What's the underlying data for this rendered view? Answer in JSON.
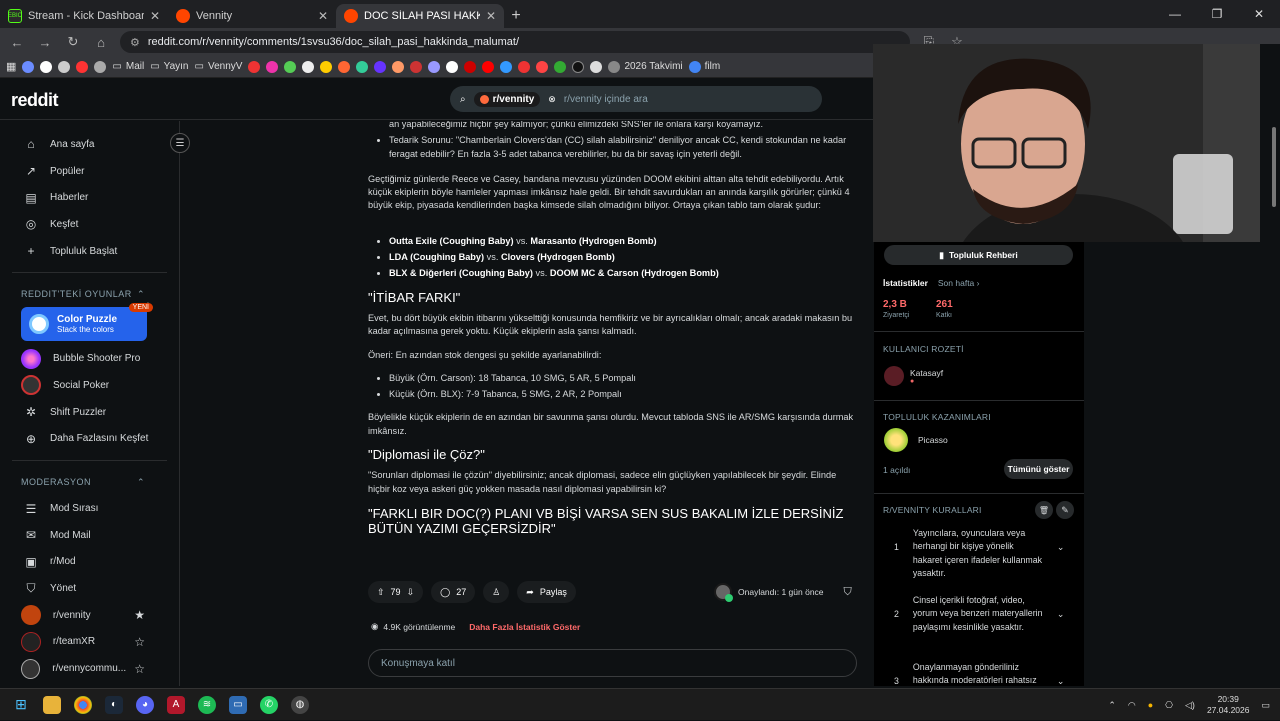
{
  "browser": {
    "tabs": [
      {
        "title": "Stream - Kick Dashboard",
        "favicon_color": "#53fc18",
        "badge": "EBIC"
      },
      {
        "title": "Vennity",
        "favicon_color": "#ff4500"
      },
      {
        "title": "DOC SİLAH PASI HAKKINDA M",
        "favicon_color": "#ff4500"
      }
    ],
    "url": "reddit.com/r/vennity/comments/1svsu36/doc_silah_pasi_hakkinda_malumat/",
    "bookmarks": [
      "Mail",
      "Yayın",
      "VennyV",
      "2026 Takvimi",
      "film"
    ]
  },
  "reddit": {
    "logo": "reddit",
    "search_chip": "r/vennity",
    "search_placeholder": "r/vennity içinde ara"
  },
  "sidebar": {
    "nav": [
      "Ana sayfa",
      "Popüler",
      "Haberler",
      "Keşfet",
      "Topluluk Başlat"
    ],
    "games_header": "REDDIT'TEKİ OYUNLAR",
    "promo": {
      "title": "Color Puzzle",
      "subtitle": "Stack the colors",
      "badge": "YENİ"
    },
    "games": [
      "Bubble Shooter Pro",
      "Social Poker",
      "Shift Puzzler",
      "Daha Fazlasını Keşfet"
    ],
    "mod_header": "MODERASYON",
    "mod": [
      "Mod Sırası",
      "Mod Mail",
      "r/Mod",
      "Yönet"
    ],
    "communities": [
      "r/vennity",
      "r/teamXR",
      "r/vennycommu..."
    ]
  },
  "post": {
    "bullet_a1": "an yapabileceğimiz hiçbir şey kalmıyor; çünkü elimizdeki SNS'ler ile onlara karşı koyamayız.",
    "bullet_a2": "Tedarik Sorunu: \"Chamberlain Clovers'dan (CC) silah alabilirsiniz\" deniliyor ancak CC, kendi stokundan ne kadar feragat edebilir? En fazla 3-5 adet tabanca verebilirler, bu da bir savaş için yeterli değil.",
    "para1": "Geçtiğimiz günlerde Reece ve Casey, bandana mevzusu yüzünden DOOM ekibini alttan alta tehdit edebiliyordu. Artık küçük ekiplerin böyle hamleler yapması imkânsız hale geldi. Bir tehdit savurdukları an anında karşılık görürler; çünkü 4 büyük ekip, piyasada kendilerinden başka kimsede silah olmadığını biliyor. Ortaya çıkan tablo tam olarak şudur:",
    "matchups": [
      {
        "a": "Outta Exile (Coughing Baby)",
        "vs": "vs.",
        "b": "Marasanto (Hydrogen Bomb)"
      },
      {
        "a": "LDA (Coughing Baby)",
        "vs": "vs.",
        "b": "Clovers (Hydrogen Bomb)"
      },
      {
        "a": "BLX & Diğerleri (Coughing Baby)",
        "vs": "vs.",
        "b": "DOOM MC & Carson (Hydrogen Bomb)"
      }
    ],
    "h_itibar": "\"İTİBAR FARKI\"",
    "para2": "Evet, bu dört büyük ekibin itibarını yükselttiği konusunda hemfikiriz ve bir ayrıcalıkları olmalı; ancak aradaki makasın bu kadar açılmasına gerek yoktu. Küçük ekiplerin asla şansı kalmadı.",
    "para3": "Öneri: En azından stok dengesi şu şekilde ayarlanabilirdi:",
    "stock": [
      "Büyük (Örn. Carson): 18 Tabanca, 10 SMG, 5 AR, 5 Pompalı",
      "Küçük (Örn. BLX): 7-9 Tabanca, 5 SMG, 2 AR, 2 Pompalı"
    ],
    "para4": "Böylelikle küçük ekiplerin de en azından bir savunma şansı olurdu. Mevcut tabloda SNS ile AR/SMG karşısında durmak imkânsız.",
    "h_diplomasi": "\"Diplomasi ile Çöz?\"",
    "para5": "\"Sorunları diplomasi ile çözün\" diyebilirsiniz; ancak diplomasi, sadece elin güçlüyken yapılabilecek bir şeydir. Elinde hiçbir koz veya askeri güç yokken masada nasıl diplomasi yapabilirsin ki?",
    "h_final": "\"FARKLI BIR DOC(?) PLANI VB BİŞİ VARSA SEN SUS BAKALIM İZLE DERSİNİZ BÜTÜN YAZIMI GEÇERSİZDİR\"",
    "votes": "79",
    "comments": "27",
    "share": "Paylaş",
    "approved": "Onaylandı: 1 gün önce",
    "views": "4.9K görüntülenme",
    "more_stats": "Daha Fazla İstatistik Göster",
    "comment_placeholder": "Konuşmaya katıl"
  },
  "right": {
    "guide_button": "Topluluk Rehberi",
    "stats_label": "İstatistikler",
    "stats_period": "Son hafta",
    "visits_value": "2,3 B",
    "visits_label": "Ziyaretçi",
    "contrib_value": "261",
    "contrib_label": "Katkı",
    "badge_header": "KULLANICI ROZETİ",
    "badge_user": "Katasayf",
    "achievements_header": "TOPLULUK KAZANIMLARI",
    "achievement_name": "Picasso",
    "unlocked": "1 açıldı",
    "show_all": "Tümünü göster",
    "rules_header": "R/VENNİTY KURALLARI",
    "rules": [
      {
        "n": "1",
        "text": "Yayıncılara, oyunculara veya herhangi bir kişiye yönelik hakaret içeren ifadeler kullanmak yasaktır."
      },
      {
        "n": "2",
        "text": "Cinsel içerikli fotoğraf, video, yorum veya benzeri materyallerin paylaşımı kesinlikle yasaktır."
      },
      {
        "n": "3",
        "text": "Onaylanmayan gönderiliniz hakkında moderatörleri rahatsız"
      }
    ]
  },
  "taskbar": {
    "time": "20:39",
    "date": "27.04.2026"
  }
}
